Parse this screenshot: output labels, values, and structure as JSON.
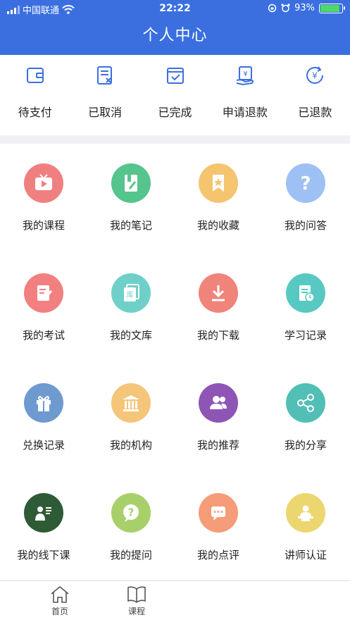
{
  "status_bar": {
    "carrier": "中国联通",
    "time": "22:22",
    "battery": "93%"
  },
  "header": {
    "title": "个人中心",
    "color": "#3b6fe0"
  },
  "orders": [
    {
      "label": "待支付",
      "icon": "wallet-icon"
    },
    {
      "label": "已取消",
      "icon": "cancel-doc-icon"
    },
    {
      "label": "已完成",
      "icon": "check-calendar-icon"
    },
    {
      "label": "申请退款",
      "icon": "refund-request-icon"
    },
    {
      "label": "已退款",
      "icon": "refunded-icon"
    }
  ],
  "grid": [
    {
      "label": "我的课程",
      "icon": "tv-icon",
      "color": "#f08080"
    },
    {
      "label": "我的笔记",
      "icon": "notebook-icon",
      "color": "#56c48d"
    },
    {
      "label": "我的收藏",
      "icon": "bookmark-star-icon",
      "color": "#f5c46e"
    },
    {
      "label": "我的问答",
      "icon": "question-icon",
      "color": "#9ec0f5"
    },
    {
      "label": "我的考试",
      "icon": "exam-icon",
      "color": "#f28080"
    },
    {
      "label": "我的文库",
      "icon": "library-icon",
      "color": "#6fd0c9"
    },
    {
      "label": "我的下载",
      "icon": "download-icon",
      "color": "#f0847a"
    },
    {
      "label": "学习记录",
      "icon": "study-record-icon",
      "color": "#58c9c2"
    },
    {
      "label": "兑换记录",
      "icon": "gift-icon",
      "color": "#6f9ad0"
    },
    {
      "label": "我的机构",
      "icon": "institution-icon",
      "color": "#f5c57a"
    },
    {
      "label": "我的推荐",
      "icon": "people-icon",
      "color": "#8e55b5"
    },
    {
      "label": "我的分享",
      "icon": "share-icon",
      "color": "#52bfb6"
    },
    {
      "label": "我的线下课",
      "icon": "teacher-board-icon",
      "color": "#2e5a36"
    },
    {
      "label": "我的提问",
      "icon": "ask-question-icon",
      "color": "#a8d06a"
    },
    {
      "label": "我的点评",
      "icon": "comment-icon",
      "color": "#f59c78"
    },
    {
      "label": "讲师认证",
      "icon": "lecturer-icon",
      "color": "#ecd66f"
    }
  ],
  "tabs": [
    {
      "label": "首页",
      "icon": "home-icon"
    },
    {
      "label": "课程",
      "icon": "book-icon"
    }
  ]
}
